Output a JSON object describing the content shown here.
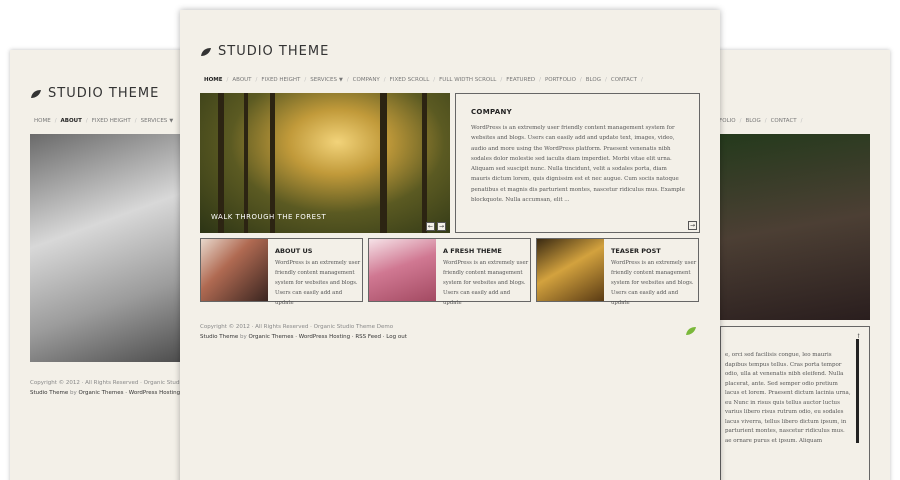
{
  "left_page": {
    "logo_text": "STUDIO THEME",
    "nav": [
      {
        "label": "HOME",
        "active": false
      },
      {
        "label": "ABOUT",
        "active": true
      },
      {
        "label": "FIXED HEIGHT",
        "active": false
      },
      {
        "label": "SERVICES",
        "active": false
      }
    ],
    "footer_line1": "Copyright © 2012 · All Rights Reserved · Organic Studio Th",
    "footer_theme": "Studio Theme",
    "footer_by": " by ",
    "footer_org": "Organic Themes",
    "footer_rest": " · WordPress Hosting · R"
  },
  "center_page": {
    "logo_text": "STUDIO THEME",
    "nav": [
      {
        "label": "HOME",
        "active": true
      },
      {
        "label": "ABOUT",
        "active": false
      },
      {
        "label": "FIXED HEIGHT",
        "active": false
      },
      {
        "label": "SERVICES",
        "active": false
      },
      {
        "label": "COMPANY",
        "active": false
      },
      {
        "label": "FIXED SCROLL",
        "active": false
      },
      {
        "label": "FULL WIDTH SCROLL",
        "active": false
      },
      {
        "label": "FEATURED",
        "active": false
      },
      {
        "label": "PORTFOLIO",
        "active": false
      },
      {
        "label": "BLOG",
        "active": false
      },
      {
        "label": "CONTACT",
        "active": false
      }
    ],
    "slider_caption": "WALK THROUGH THE FOREST",
    "slider_prev": "←",
    "slider_next": "→",
    "company_title": "COMPANY",
    "company_text": "WordPress is an extremely user friendly content management system for websites and blogs. Users can easily add and update text, images, video, audio and more using the WordPress platform. Praesent venenatis nibh sodales dolor molestie sed iaculis diam imperdiet. Morbi vitae elit urna. Aliquam sed suscipit nunc. Nulla tincidunt, velit a sodales porta, diam mauris dictum lorem, quis dignissim est et nec augue. Cum sociis natoque penatibus et magnis dis parturient montes, nascetur ridiculus mus. Example blockquote. Nulla accumsan, elit ...",
    "company_more": "→",
    "teasers": [
      {
        "title": "ABOUT US",
        "text": "WordPress is an extremely user friendly content management system for websites and blogs. Users can easily add and update"
      },
      {
        "title": "A FRESH THEME",
        "text": "WordPress is an extremely user friendly content management system for websites and blogs. Users can easily add and update"
      },
      {
        "title": "TEASER POST",
        "text": "WordPress is an extremely user friendly content management system for websites and blogs. Users can easily add and update"
      }
    ],
    "footer_line1": "Copyright © 2012 · All Rights Reserved · Organic Studio Theme Demo",
    "footer_theme": "Studio Theme",
    "footer_by": " by ",
    "footer_org": "Organic Themes",
    "footer_links": " · WordPress Hosting · RSS Feed · Log out"
  },
  "right_page": {
    "nav": [
      {
        "label": "ORTFOLIO"
      },
      {
        "label": "BLOG"
      },
      {
        "label": "CONTACT"
      }
    ],
    "scroll_text": "e, orci sed facilisis congue, leo mauris dapibus tempus tellus. Cras porta tempor odio, ulla at venenatis nibh eleifend. Nulla placerat, ante. Sed semper odio pretium lacus et lorem. Praesent dictum lacinia urna, eu Nunc in risus quis tellus auctor luctus varius libero risus rutrum odio, eu sodales lacus viverra, tellus libero dictum ipsum, in parturient montes, nascetur ridiculus mus. ae ornare purus et ipsum. Aliquam",
    "scroll_up": "↑"
  },
  "colors": {
    "page_bg": "#f3f0e8",
    "border": "#666666",
    "leaf_green": "#7ab83a"
  }
}
